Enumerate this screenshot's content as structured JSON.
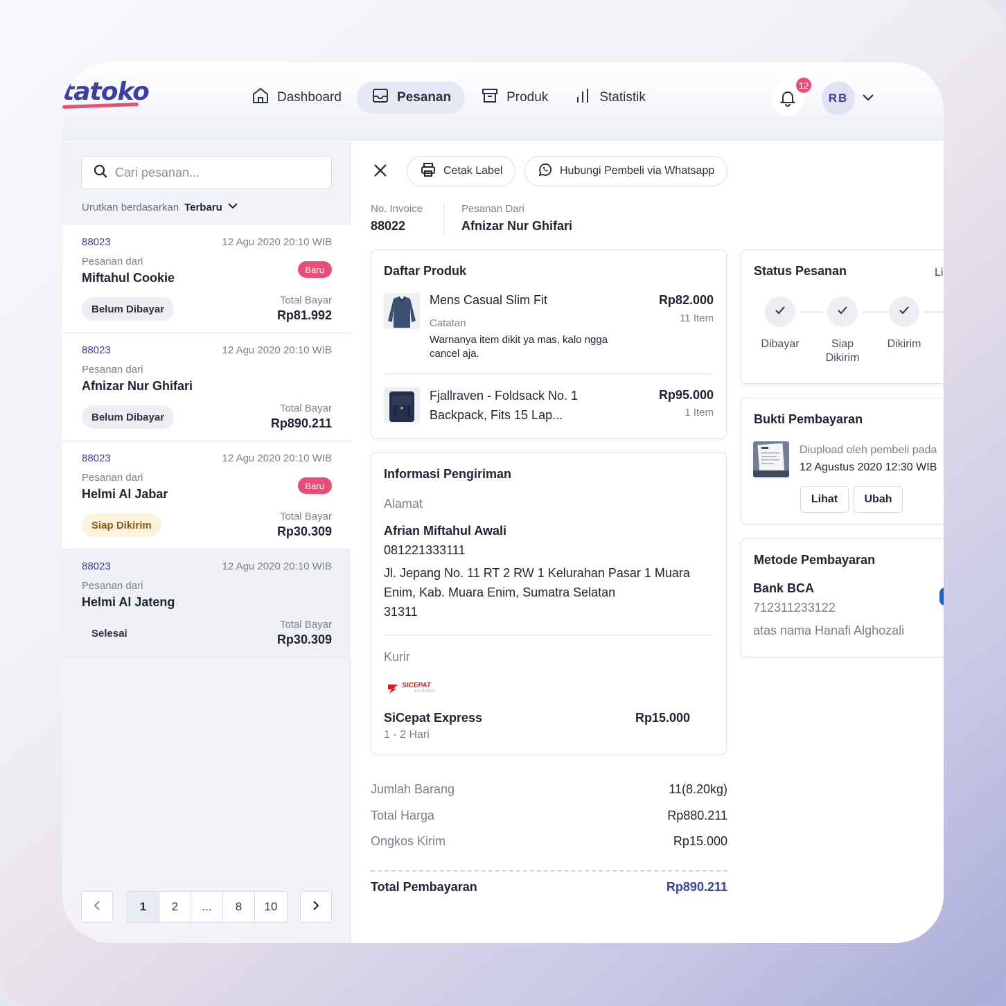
{
  "brand": {
    "logo_text": "tatoko",
    "accent": "#3b3fa0",
    "pink": "#e94f74"
  },
  "nav": {
    "items": [
      {
        "label": "Dashboard",
        "icon": "home-icon"
      },
      {
        "label": "Pesanan",
        "icon": "inbox-icon",
        "active": true
      },
      {
        "label": "Produk",
        "icon": "box-icon"
      },
      {
        "label": "Statistik",
        "icon": "bar-chart-icon"
      }
    ]
  },
  "notifications": {
    "count": "12"
  },
  "user": {
    "initials": "RB"
  },
  "search": {
    "placeholder": "Cari pesanan..."
  },
  "sort": {
    "label": "Urutkan berdasarkan",
    "value": "Terbaru"
  },
  "orders": [
    {
      "id": "88023",
      "date": "12 Agu 2020 20:10 WIB",
      "from_label": "Pesanan dari",
      "name": "Miftahul Cookie",
      "badge": "Baru",
      "status": "Belum Dibayar",
      "total_label": "Total Bayar",
      "total": "Rp81.992"
    },
    {
      "id": "88023",
      "date": "12 Agu 2020 20:10 WIB",
      "from_label": "Pesanan dari",
      "name": "Afnizar Nur Ghifari",
      "badge": "",
      "status": "Belum Dibayar",
      "total_label": "Total Bayar",
      "total": "Rp890.211"
    },
    {
      "id": "88023",
      "date": "12 Agu 2020 20:10 WIB",
      "from_label": "Pesanan dari",
      "name": "Helmi Al Jabar",
      "badge": "Baru",
      "status": "Siap Dikirim",
      "total_label": "Total Bayar",
      "total": "Rp30.309"
    },
    {
      "id": "88023",
      "date": "12 Agu 2020 20:10 WIB",
      "from_label": "Pesanan dari",
      "name": "Helmi Al Jateng",
      "badge": "",
      "status": "Selesai",
      "total_label": "Total Bayar",
      "total": "Rp30.309"
    }
  ],
  "pagination": {
    "pages": [
      "1",
      "2",
      "...",
      "8",
      "10"
    ],
    "current": "1"
  },
  "detail": {
    "actions": {
      "print_label": "Cetak Label",
      "whatsapp": "Hubungi Pembeli via Whatsapp"
    },
    "invoice_label": "No. Invoice",
    "invoice": "88022",
    "from_label": "Pesanan Dari",
    "from": "Afnizar Nur Ghifari",
    "products_title": "Daftar Produk",
    "products": [
      {
        "name": "Mens Casual Slim Fit",
        "price": "Rp82.000",
        "qty": "11 Item",
        "note_label": "Catatan",
        "note": "Warnanya item dikit ya mas, kalo ngga cancel aja."
      },
      {
        "name": "Fjallraven - Foldsack No. 1 Backpack, Fits 15 Lap...",
        "price": "Rp95.000",
        "qty": "1 Item"
      }
    ],
    "shipping": {
      "title": "Informasi Pengiriman",
      "address_label": "Alamat",
      "recipient": "Afrian Miftahul Awali",
      "phone": "081221333111",
      "address": "Jl. Jepang No. 11 RT 2 RW 1 Kelurahan Pasar 1 Muara Enim, Kab. Muara Enim, Sumatra Selatan",
      "postal": "31311",
      "courier_label": "Kurir",
      "courier_logo": "SICEPAT",
      "courier_logo_sub": "EKSPRES",
      "courier": "SiCepat Express",
      "courier_price": "Rp15.000",
      "eta": "1 - 2 Hari"
    },
    "summary": {
      "items_label": "Jumlah Barang",
      "items": "11(8.20kg)",
      "subtotal_label": "Total Harga",
      "subtotal": "Rp880.211",
      "shipping_label": "Ongkos Kirim",
      "shipping": "Rp15.000",
      "total_label": "Total Pembayaran",
      "total": "Rp890.211"
    },
    "status": {
      "title": "Status Pesanan",
      "link": "Li",
      "steps": [
        "Dibayar",
        "Siap Dikirim",
        "Dikirim"
      ]
    },
    "proof": {
      "title": "Bukti Pembayaran",
      "uploaded_label": "Diupload oleh pembeli pada",
      "uploaded_at": "12 Agustus 2020 12:30 WIB",
      "view": "Lihat",
      "edit": "Ubah"
    },
    "payment": {
      "title": "Metode Pembayaran",
      "bank": "Bank BCA",
      "account": "712311233122",
      "holder": "atas nama Hanafi Alghozali"
    }
  }
}
